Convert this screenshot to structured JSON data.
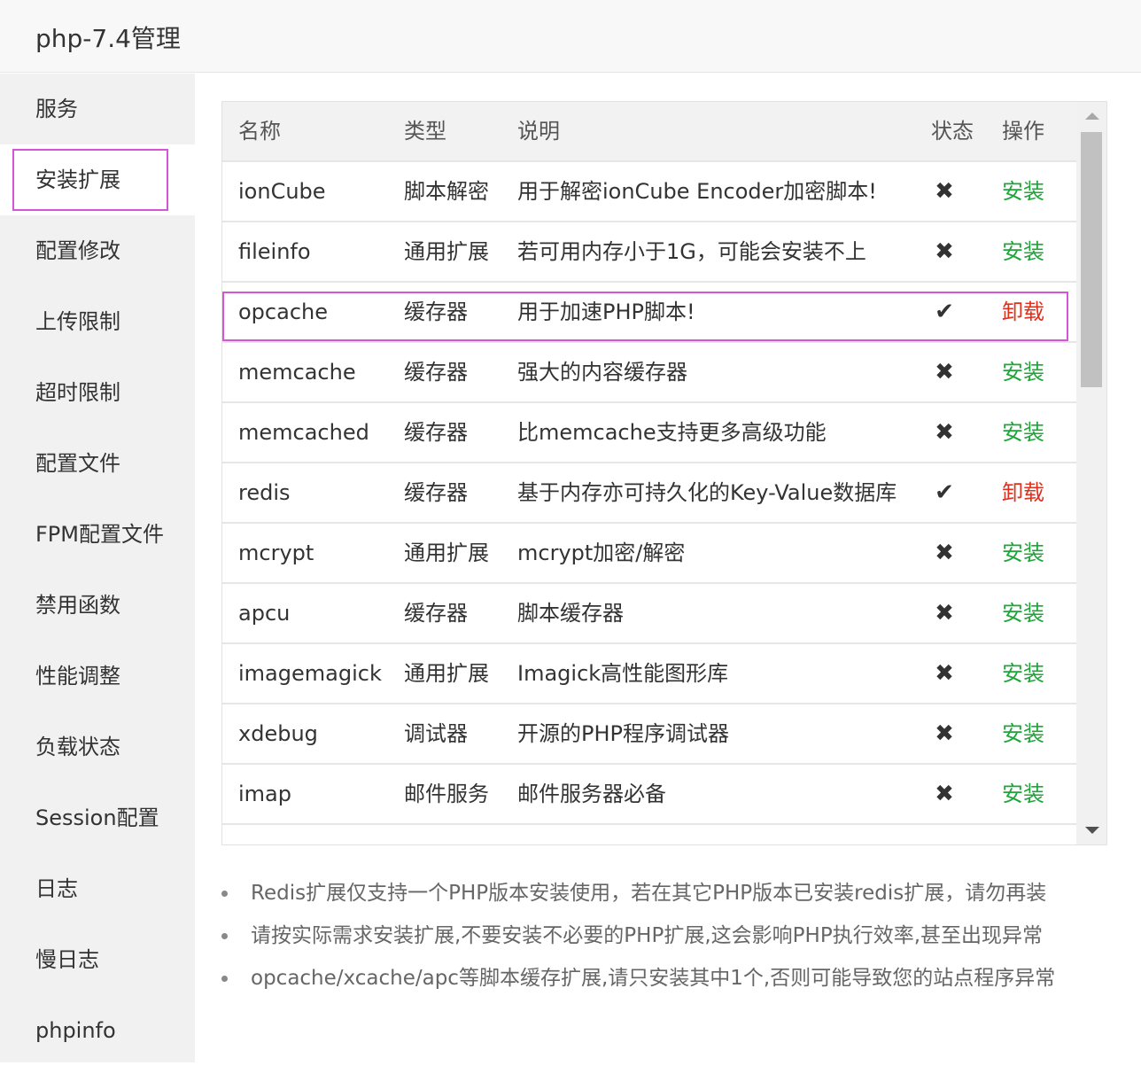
{
  "window": {
    "title": "php-7.4管理"
  },
  "sidebar": {
    "items": [
      {
        "label": "服务"
      },
      {
        "label": "安装扩展",
        "active": true
      },
      {
        "label": "配置修改"
      },
      {
        "label": "上传限制"
      },
      {
        "label": "超时限制"
      },
      {
        "label": "配置文件"
      },
      {
        "label": "FPM配置文件"
      },
      {
        "label": "禁用函数"
      },
      {
        "label": "性能调整"
      },
      {
        "label": "负载状态"
      },
      {
        "label": "Session配置"
      },
      {
        "label": "日志"
      },
      {
        "label": "慢日志"
      },
      {
        "label": "phpinfo"
      }
    ]
  },
  "table": {
    "headers": {
      "name": "名称",
      "type": "类型",
      "desc": "说明",
      "status": "状态",
      "op": "操作"
    },
    "rows": [
      {
        "name": "ionCube",
        "type": "脚本解密",
        "desc": "用于解密ionCube Encoder加密脚本!",
        "status": "✖",
        "installed": false,
        "op": "安装"
      },
      {
        "name": "fileinfo",
        "type": "通用扩展",
        "desc": "若可用内存小于1G，可能会安装不上",
        "status": "✖",
        "installed": false,
        "op": "安装"
      },
      {
        "name": "opcache",
        "type": "缓存器",
        "desc": "用于加速PHP脚本!",
        "status": "✔",
        "installed": true,
        "op": "卸载",
        "highlighted": true
      },
      {
        "name": "memcache",
        "type": "缓存器",
        "desc": "强大的内容缓存器",
        "status": "✖",
        "installed": false,
        "op": "安装"
      },
      {
        "name": "memcached",
        "type": "缓存器",
        "desc": "比memcache支持更多高级功能",
        "status": "✖",
        "installed": false,
        "op": "安装"
      },
      {
        "name": "redis",
        "type": "缓存器",
        "desc": "基于内存亦可持久化的Key-Value数据库",
        "status": "✔",
        "installed": true,
        "op": "卸载"
      },
      {
        "name": "mcrypt",
        "type": "通用扩展",
        "desc": "mcrypt加密/解密",
        "status": "✖",
        "installed": false,
        "op": "安装"
      },
      {
        "name": "apcu",
        "type": "缓存器",
        "desc": "脚本缓存器",
        "status": "✖",
        "installed": false,
        "op": "安装"
      },
      {
        "name": "imagemagick",
        "type": "通用扩展",
        "desc": "Imagick高性能图形库",
        "status": "✖",
        "installed": false,
        "op": "安装"
      },
      {
        "name": "xdebug",
        "type": "调试器",
        "desc": "开源的PHP程序调试器",
        "status": "✖",
        "installed": false,
        "op": "安装"
      },
      {
        "name": "imap",
        "type": "邮件服务",
        "desc": "邮件服务器必备",
        "status": "✖",
        "installed": false,
        "op": "安装"
      }
    ]
  },
  "notes": [
    "Redis扩展仅支持一个PHP版本安装使用，若在其它PHP版本已安装redis扩展，请勿再装",
    "请按实际需求安装扩展,不要安装不必要的PHP扩展,这会影响PHP执行效率,甚至出现异常",
    "opcache/xcache/apc等脚本缓存扩展,请只安装其中1个,否则可能导致您的站点程序异常"
  ],
  "colors": {
    "install": "#20a53a",
    "uninstall": "#e0301e",
    "highlight": "#d654d6",
    "sidebar_bg": "#f1f1f1"
  }
}
